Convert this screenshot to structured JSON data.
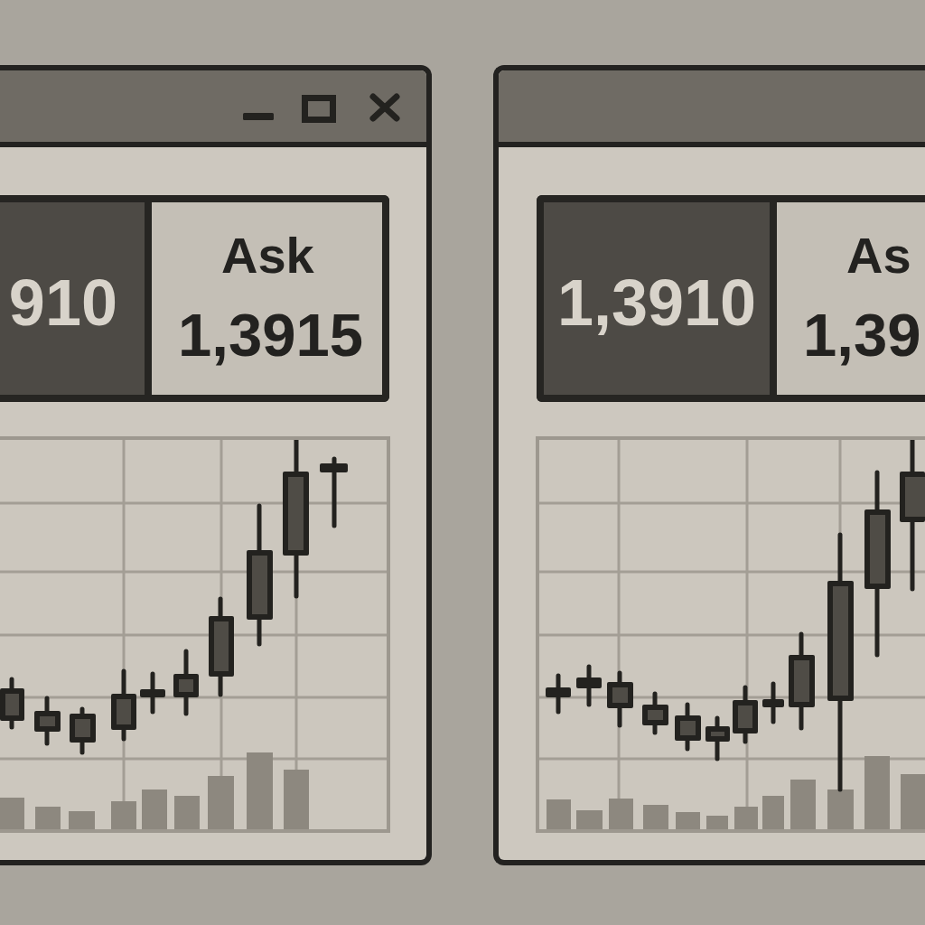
{
  "windows": [
    {
      "title_bar": {
        "controls": [
          {
            "kind": "minimize"
          },
          {
            "kind": "maximize"
          },
          {
            "kind": "close"
          }
        ]
      },
      "quote": {
        "bid": {
          "value": "910"
        },
        "ask": {
          "label": "Ask",
          "value": "1,3915"
        }
      }
    },
    {
      "quote": {
        "bid": {
          "value": "1,3910"
        },
        "ask": {
          "label": "As",
          "value": "1,39"
        }
      }
    }
  ]
}
